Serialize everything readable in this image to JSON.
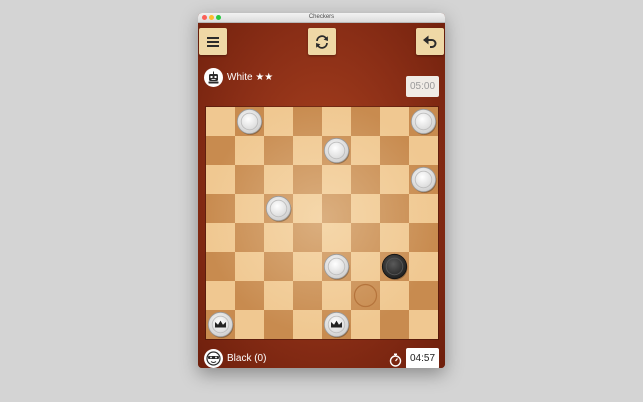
{
  "window": {
    "title": "Checkers"
  },
  "toolbar": {
    "menu_icon": "menu-icon",
    "restart_icon": "refresh-icon",
    "undo_icon": "undo-icon"
  },
  "opponent": {
    "name": "White ★★",
    "avatar_icon": "robot-icon",
    "timer": "05:00"
  },
  "player": {
    "name": "Black (0)",
    "avatar_icon": "masked-face-icon",
    "clock_icon": "stopwatch-icon",
    "timer": "04:57"
  },
  "colors": {
    "frame": "#8a2e16",
    "button": "#efd8a6",
    "light_square": "#f0c891",
    "dark_square": "#c88b4f",
    "white_piece": "#f7f7f7",
    "black_piece": "#3a3a3a"
  },
  "board": {
    "size": 8,
    "pieces": [
      {
        "row": 0,
        "col": 1,
        "color": "white",
        "king": false
      },
      {
        "row": 0,
        "col": 7,
        "color": "white",
        "king": false
      },
      {
        "row": 1,
        "col": 4,
        "color": "white",
        "king": false
      },
      {
        "row": 2,
        "col": 7,
        "color": "white",
        "king": false
      },
      {
        "row": 3,
        "col": 2,
        "color": "white",
        "king": false
      },
      {
        "row": 5,
        "col": 4,
        "color": "white",
        "king": false
      },
      {
        "row": 5,
        "col": 6,
        "color": "black",
        "king": false
      },
      {
        "row": 7,
        "col": 0,
        "color": "white",
        "king": true
      },
      {
        "row": 7,
        "col": 4,
        "color": "white",
        "king": true
      }
    ],
    "move_hint": {
      "row": 6,
      "col": 5
    }
  }
}
